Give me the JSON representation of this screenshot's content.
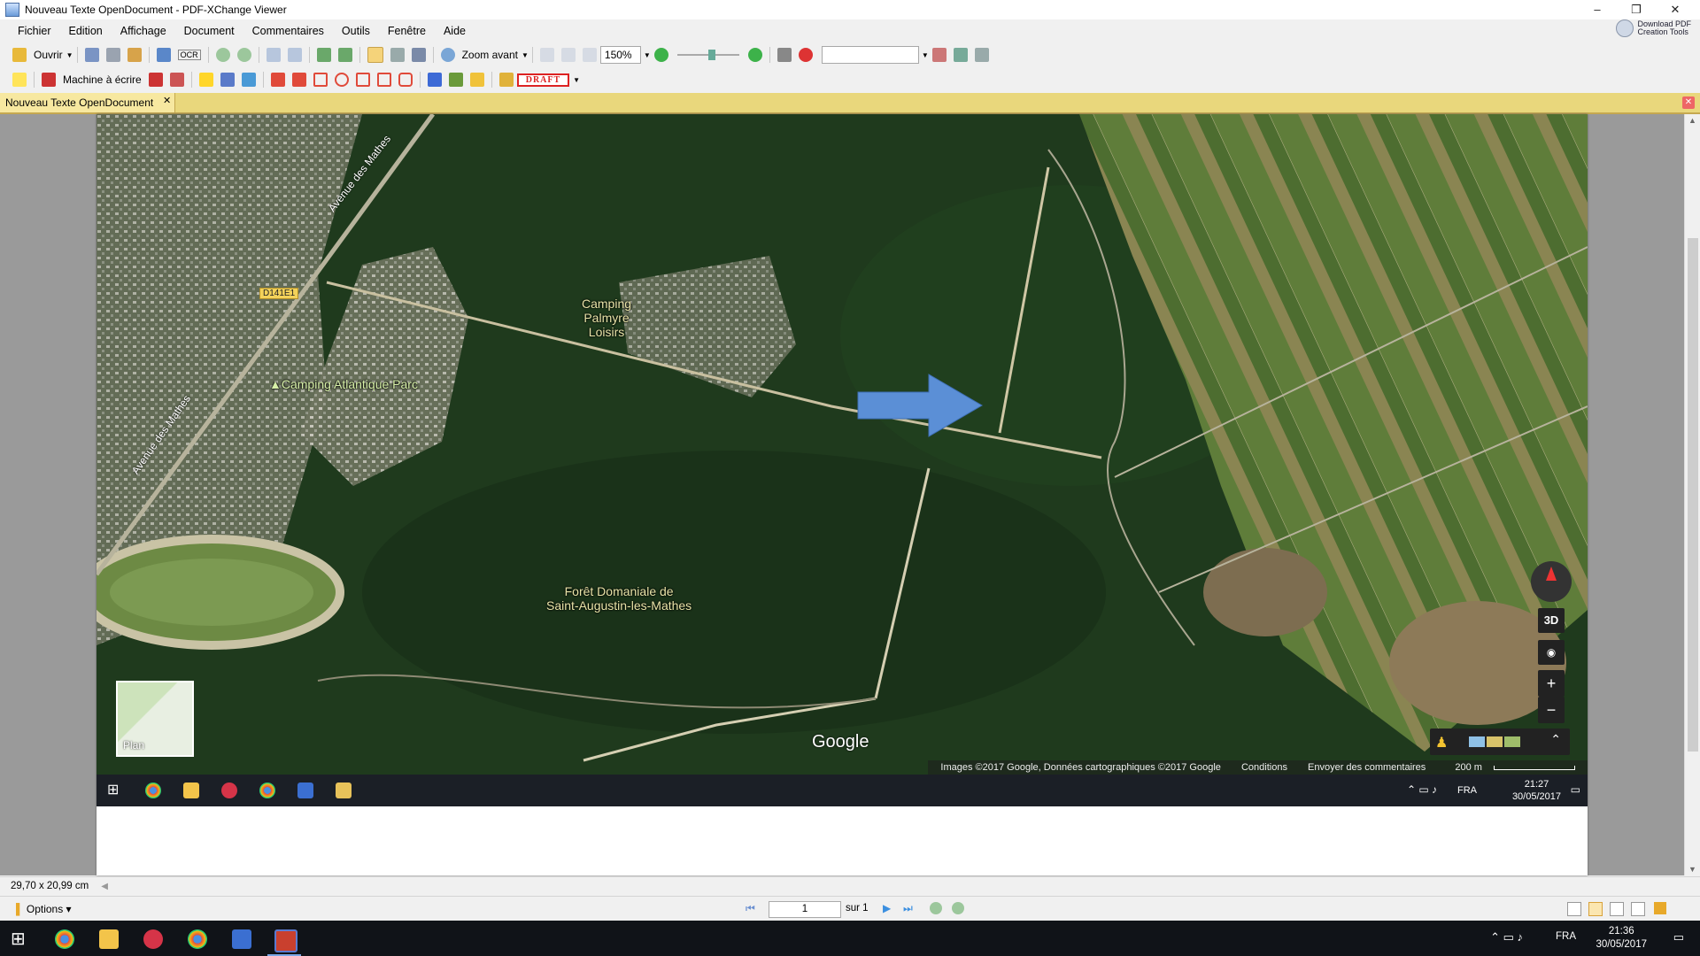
{
  "window": {
    "title": "Nouveau Texte OpenDocument - PDF-XChange Viewer",
    "download_label_line1": "Download PDF",
    "download_label_line2": "Creation Tools"
  },
  "menu": [
    "Fichier",
    "Edition",
    "Affichage",
    "Document",
    "Commentaires",
    "Outils",
    "Fenêtre",
    "Aide"
  ],
  "toolbar1": {
    "open_label": "Ouvrir",
    "ocr_label": "OCR",
    "zoom_label": "Zoom avant",
    "zoom_value": "150%"
  },
  "toolbar2": {
    "typewriter_label": "Machine à écrire",
    "stamp_label": "DRAFT"
  },
  "doc_tab": {
    "label": "Nouveau Texte OpenDocument"
  },
  "map": {
    "labels": {
      "camping_palmyre": [
        "Camping",
        "Palmyre",
        "Loisirs"
      ],
      "camping_atlantique": "Camping Atlantique Parc",
      "foret": [
        "Forêt Domaniale de",
        "Saint-Augustin-les-Mathes"
      ],
      "avenue_top": "Avenue des Mathes",
      "avenue_bottom": "Avenue des Mathes",
      "road_shield": "D141E1"
    },
    "plan_label": "Plan",
    "google": "Google",
    "controls": {
      "3d": "3D",
      "plus": "+",
      "minus": "−"
    },
    "attribution": {
      "images": "Images ©2017 Google, Données cartographiques ©2017 Google",
      "conditions": "Conditions",
      "feedback": "Envoyer des commentaires",
      "scale": "200 m"
    }
  },
  "inner_taskbar": {
    "lang": "FRA",
    "time": "21:27",
    "date": "30/05/2017"
  },
  "status": {
    "page_size": "29,70 x 20,99 cm",
    "options_label": "Options",
    "page_current": "1",
    "page_total": "sur 1"
  },
  "taskbar": {
    "lang": "FRA",
    "time": "21:36",
    "date": "30/05/2017"
  },
  "colors": {
    "tab_bar": "#e9d77c",
    "forest": "#1f3a1d",
    "arrow": "#5b8fd6"
  }
}
